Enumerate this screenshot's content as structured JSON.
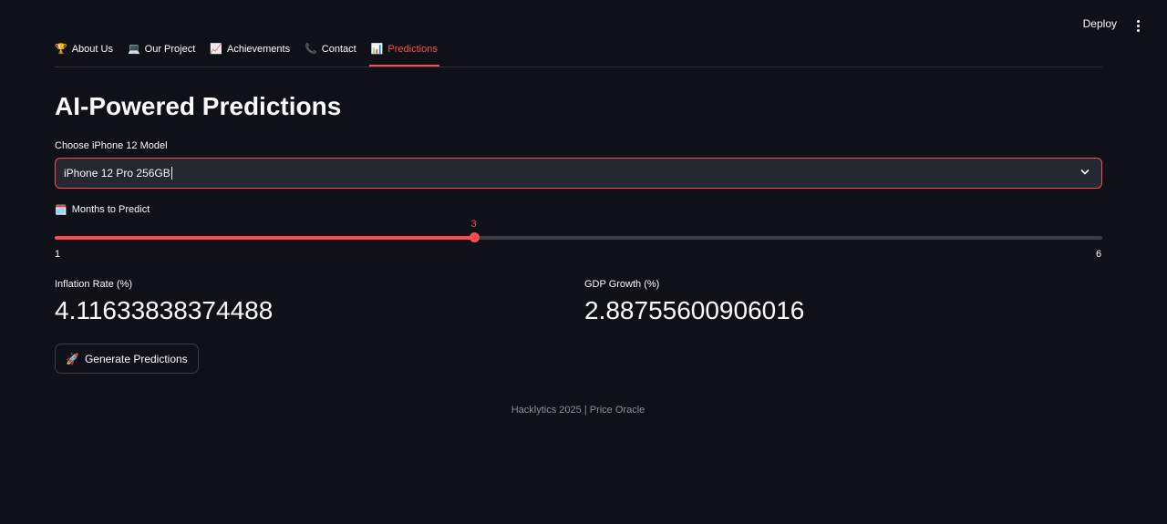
{
  "header": {
    "deploy_label": "Deploy",
    "menu_icon": "kebab-menu-icon"
  },
  "tabs": [
    {
      "icon": "🏆",
      "icon_name": "trophy-icon",
      "label": "About Us",
      "active": false
    },
    {
      "icon": "💻",
      "icon_name": "laptop-icon",
      "label": "Our Project",
      "active": false
    },
    {
      "icon": "📈",
      "icon_name": "chart-up-icon",
      "label": "Achievements",
      "active": false
    },
    {
      "icon": "📞",
      "icon_name": "phone-icon",
      "label": "Contact",
      "active": false
    },
    {
      "icon": "📊",
      "icon_name": "bar-chart-icon",
      "label": "Predictions",
      "active": true
    }
  ],
  "main": {
    "title": "AI-Powered Predictions",
    "model_select": {
      "label": "Choose iPhone 12 Model",
      "value": "iPhone 12 Pro 256GB"
    },
    "months_slider": {
      "icon": "🗓️",
      "icon_name": "calendar-icon",
      "label": "Months to Predict",
      "min": 1,
      "max": 6,
      "value": 3,
      "min_label": "1",
      "max_label": "6",
      "value_label": "3"
    },
    "metrics": {
      "inflation_label": "Inflation Rate (%)",
      "inflation_value": "4.11633838374488",
      "gdp_label": "GDP Growth (%)",
      "gdp_value": "2.88755600906016"
    },
    "generate_button": {
      "icon": "🚀",
      "icon_name": "rocket-icon",
      "label": "Generate Predictions"
    }
  },
  "footer": {
    "text": "Hacklytics 2025 | Price Oracle"
  },
  "colors": {
    "background": "#0e1117",
    "accent": "#ff4b4b",
    "input_bg": "#262730",
    "text": "#fafafa",
    "muted": "#8b8f98"
  }
}
